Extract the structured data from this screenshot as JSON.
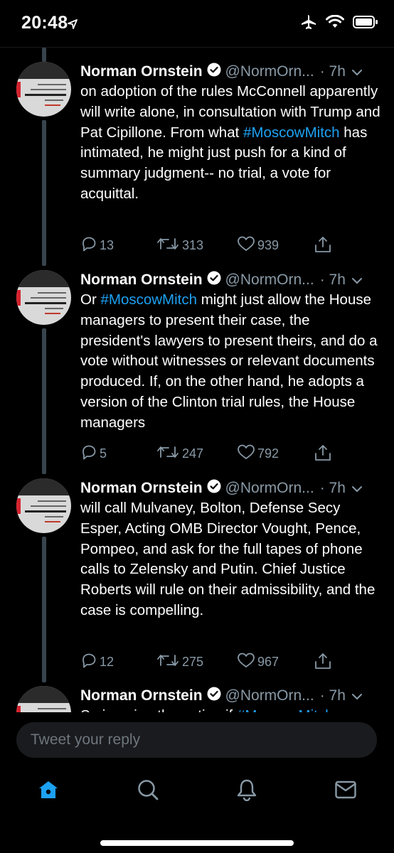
{
  "status_bar": {
    "time": "20:48"
  },
  "tweets": [
    {
      "name": "Norman Ornstein",
      "handle": "@NormOrn...",
      "time": "· 7h",
      "text_parts": [
        {
          "t": "on adoption of the rules McConnell apparently will write alone, in consultation with Trump and Pat Cipillone. From what "
        },
        {
          "t": "#MoscowMitch",
          "tag": true
        },
        {
          "t": " has intimated, he might just push for a kind of summary judgment-- no trial, a vote for acquittal."
        }
      ],
      "replies": "13",
      "retweets": "313",
      "likes": "939"
    },
    {
      "name": "Norman Ornstein",
      "handle": "@NormOrn...",
      "time": "· 7h",
      "text_parts": [
        {
          "t": "Or "
        },
        {
          "t": "#MoscowMitch",
          "tag": true
        },
        {
          "t": " might just allow the House managers to present their case, the president's lawyers to present theirs, and do a vote without witnesses or relevant documents produced. If, on the other hand, he adopts a version of the Clinton trial rules, the House managers"
        }
      ],
      "replies": "5",
      "retweets": "247",
      "likes": "792"
    },
    {
      "name": "Norman Ornstein",
      "handle": "@NormOrn...",
      "time": "· 7h",
      "text_parts": [
        {
          "t": "will call Mulvaney, Bolton, Defense Secy Esper, Acting OMB Director Vought, Pence, Pompeo, and ask for the full tapes of phone calls to Zelensky and Putin. Chief Justice Roberts will rule on their admissibility, and the case is compelling."
        }
      ],
      "replies": "12",
      "retweets": "275",
      "likes": "967"
    },
    {
      "name": "Norman Ornstein",
      "handle": "@NormOrn...",
      "time": "· 7h",
      "text_parts": [
        {
          "t": "So imagine the option if "
        },
        {
          "t": "#MoscowMitch",
          "tag": true
        }
      ],
      "replies": "",
      "retweets": "",
      "likes": ""
    }
  ],
  "compose": {
    "placeholder": "Tweet your reply"
  },
  "colors": {
    "accent": "#1da1f2",
    "muted": "#8899a6",
    "background": "#000000",
    "thread_line": "#38444d"
  },
  "tabs": [
    {
      "icon": "home-icon",
      "active": true
    },
    {
      "icon": "search-icon",
      "active": false
    },
    {
      "icon": "bell-icon",
      "active": false
    },
    {
      "icon": "mail-icon",
      "active": false
    }
  ]
}
